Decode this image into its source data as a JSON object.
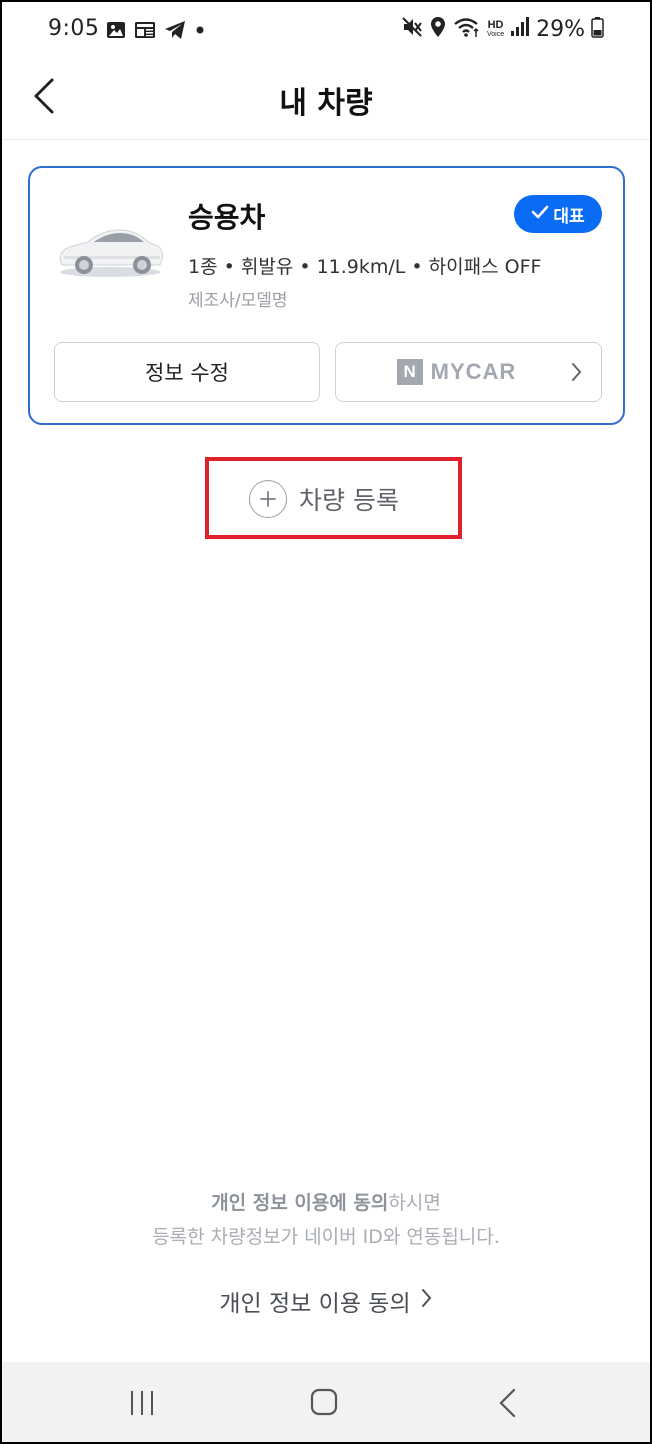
{
  "status_bar": {
    "time": "9:05",
    "battery_text": "29%",
    "hd": "HD",
    "voice": "Voice",
    "left_icons": [
      "gallery-icon",
      "news-icon",
      "telegram-icon",
      "dot-icon"
    ],
    "right_icons": [
      "mute-icon",
      "location-icon",
      "wifi-icon",
      "hd-voice-icon",
      "signal-icon",
      "battery-icon"
    ]
  },
  "header": {
    "title": "내 차량"
  },
  "vehicle": {
    "name": "승용차",
    "badge": "대표",
    "specs": "1종 • 휘발유 • 11.9km/L • 하이패스 OFF",
    "model_placeholder": "제조사/모델명",
    "edit_label": "정보 수정",
    "mycar_n": "N",
    "mycar_label": "MYCAR"
  },
  "register": {
    "label": "차량 등록"
  },
  "privacy": {
    "strong_text": "개인 정보 이용에 동의",
    "suffix_text": "하시면",
    "line2": "등록한 차량정보가 네이버 ID와 연동됩니다.",
    "link_label": "개인 정보 이용 동의"
  },
  "colors": {
    "accent": "#0a6cf5",
    "card_border": "#2f6dce",
    "highlight": "#e0202a"
  }
}
